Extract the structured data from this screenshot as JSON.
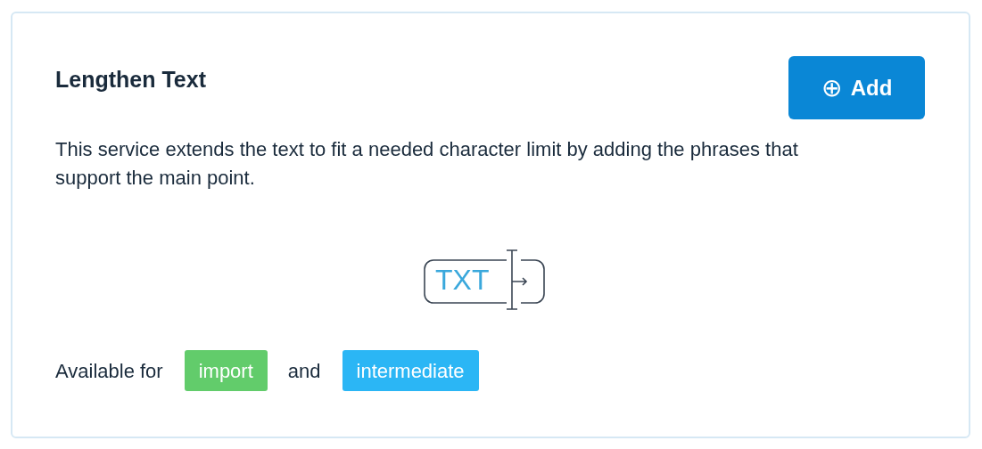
{
  "card": {
    "title": "Lengthen Text",
    "add_button": {
      "icon": "⊕",
      "label": "Add"
    },
    "description": "This service extends the text to fit a needed character limit by adding the phrases that support the main point.",
    "illustration": {
      "label": "TXT"
    },
    "availability": {
      "prefix": "Available for",
      "joiner": "and",
      "tags": [
        {
          "label": "import",
          "color": "#62cc6b"
        },
        {
          "label": "intermediate",
          "color": "#2bb6f5"
        }
      ]
    }
  }
}
